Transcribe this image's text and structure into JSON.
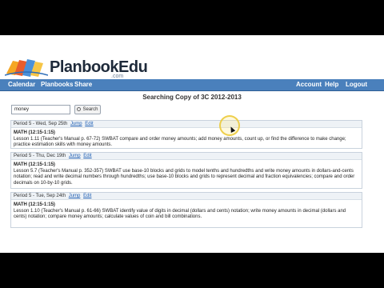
{
  "brand": {
    "name": "PlanbookEdu",
    "suffix": ".com",
    "colors": {
      "book1": "#f5a623",
      "book2": "#e85d2c",
      "book3": "#4a90d9",
      "book4": "#f6c546"
    }
  },
  "nav": {
    "left": [
      "Calendar",
      "Planbooks",
      "Share"
    ],
    "right": [
      "Account",
      "Help",
      "Logout"
    ],
    "bar_color": "#4a80bc"
  },
  "page": {
    "title": "Searching Copy of 3C 2012-2013"
  },
  "search": {
    "value": "money",
    "button_label": "Search"
  },
  "results": [
    {
      "head": "Period 5 - Wed, Sep 25th",
      "jump": "Jump",
      "edit": "Edit",
      "subject": "MATH (12:15-1:15)",
      "text": "Lesson 1.11 (Teacher's Manual p. 67-72) SWBAT compare and order money amounts; add money amounts, count up, or find the difference to make change; practice estimation skills with money amounts."
    },
    {
      "head": "Period 5 - Thu, Dec 19th",
      "jump": "Jump",
      "edit": "Edit",
      "subject": "MATH (12:15-1:15)",
      "text": "Lesson 5.7 (Teacher's Manual p. 352-357) SWBAT use base-10 blocks and grids to model tenths and hundredths and write money amounts in dollars-and-cents notation; read and write decimal numbers through hundredths; use base-10 blocks and grids to represent decimal and fraction equivalencies; compare and order decimals on 10-by-10 grids."
    },
    {
      "head": "Period 5 - Tue, Sep 24th",
      "jump": "Jump",
      "edit": "Edit",
      "subject": "MATH (12:15-1:15)",
      "text": "Lesson 1.10 (Teacher's Manual p. 61-66) SWBAT identify value of digits in decimal (dollars and cents) notation; write money amounts in decimal (dollars and cents) notation; compare money amounts; calculate values of coin and bill combinations."
    }
  ]
}
